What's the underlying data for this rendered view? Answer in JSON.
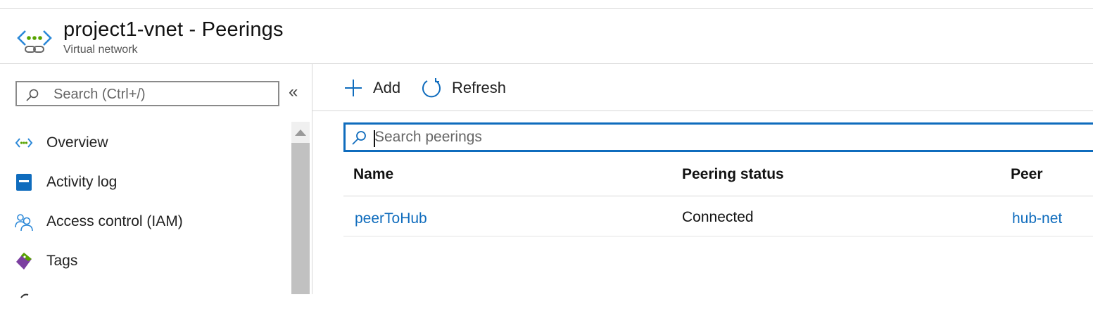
{
  "header": {
    "title": "project1-vnet - Peerings",
    "subtitle": "Virtual network"
  },
  "sidebar": {
    "search_placeholder": "Search (Ctrl+/)",
    "collapse_glyph": "«",
    "items": [
      {
        "label": "Overview",
        "icon": "vnet-icon"
      },
      {
        "label": "Activity log",
        "icon": "activity-log-icon"
      },
      {
        "label": "Access control (IAM)",
        "icon": "iam-people-icon"
      },
      {
        "label": "Tags",
        "icon": "tag-icon"
      }
    ]
  },
  "toolbar": {
    "add_label": "Add",
    "refresh_label": "Refresh"
  },
  "peerings": {
    "search_placeholder": "Search peerings",
    "columns": [
      "Name",
      "Peering status",
      "Peer"
    ],
    "rows": [
      {
        "name": "peerToHub",
        "status": "Connected",
        "peer": "hub-net"
      }
    ]
  },
  "colors": {
    "accent": "#0f6cbd",
    "vnet_dots": "#57a300",
    "border": "#d7d7d7"
  }
}
